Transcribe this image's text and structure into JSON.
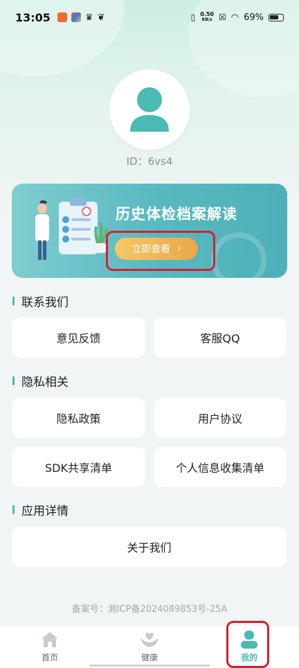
{
  "status_bar": {
    "time": "13:05",
    "net_speed_value": "0.50",
    "net_speed_unit": "KB/s",
    "battery": "69%",
    "icons": [
      "app-icon-orange",
      "app-icon-multicolor",
      "crown-icon",
      "leaf-icon",
      "vibrate-icon",
      "network-x-icon",
      "wifi-icon",
      "battery-icon"
    ]
  },
  "profile": {
    "id_text": "ID：6vs4",
    "avatar_color": "#4bbab0"
  },
  "banner": {
    "title": "历史体检档案解读",
    "button_label": "立即查看",
    "button_arrow": "›"
  },
  "sections": {
    "contact": {
      "title": "联系我们",
      "items": [
        "意见反馈",
        "客服QQ"
      ]
    },
    "privacy": {
      "title": "隐私相关",
      "items": [
        "隐私政策",
        "用户协议",
        "SDK共享清单",
        "个人信息收集清单"
      ]
    },
    "app": {
      "title": "应用详情",
      "items": [
        "关于我们"
      ]
    }
  },
  "beian": "备案号：湘ICP备2024089853号-25A",
  "tabbar": {
    "tabs": [
      {
        "label": "首页",
        "icon": "home-icon"
      },
      {
        "label": "健康",
        "icon": "heart-hands-icon"
      },
      {
        "label": "我的",
        "icon": "user-icon"
      }
    ],
    "active": 2
  },
  "colors": {
    "accent": "#4bbab0",
    "highlight": "#d81e2c",
    "banner_button": "#eaa84a"
  }
}
